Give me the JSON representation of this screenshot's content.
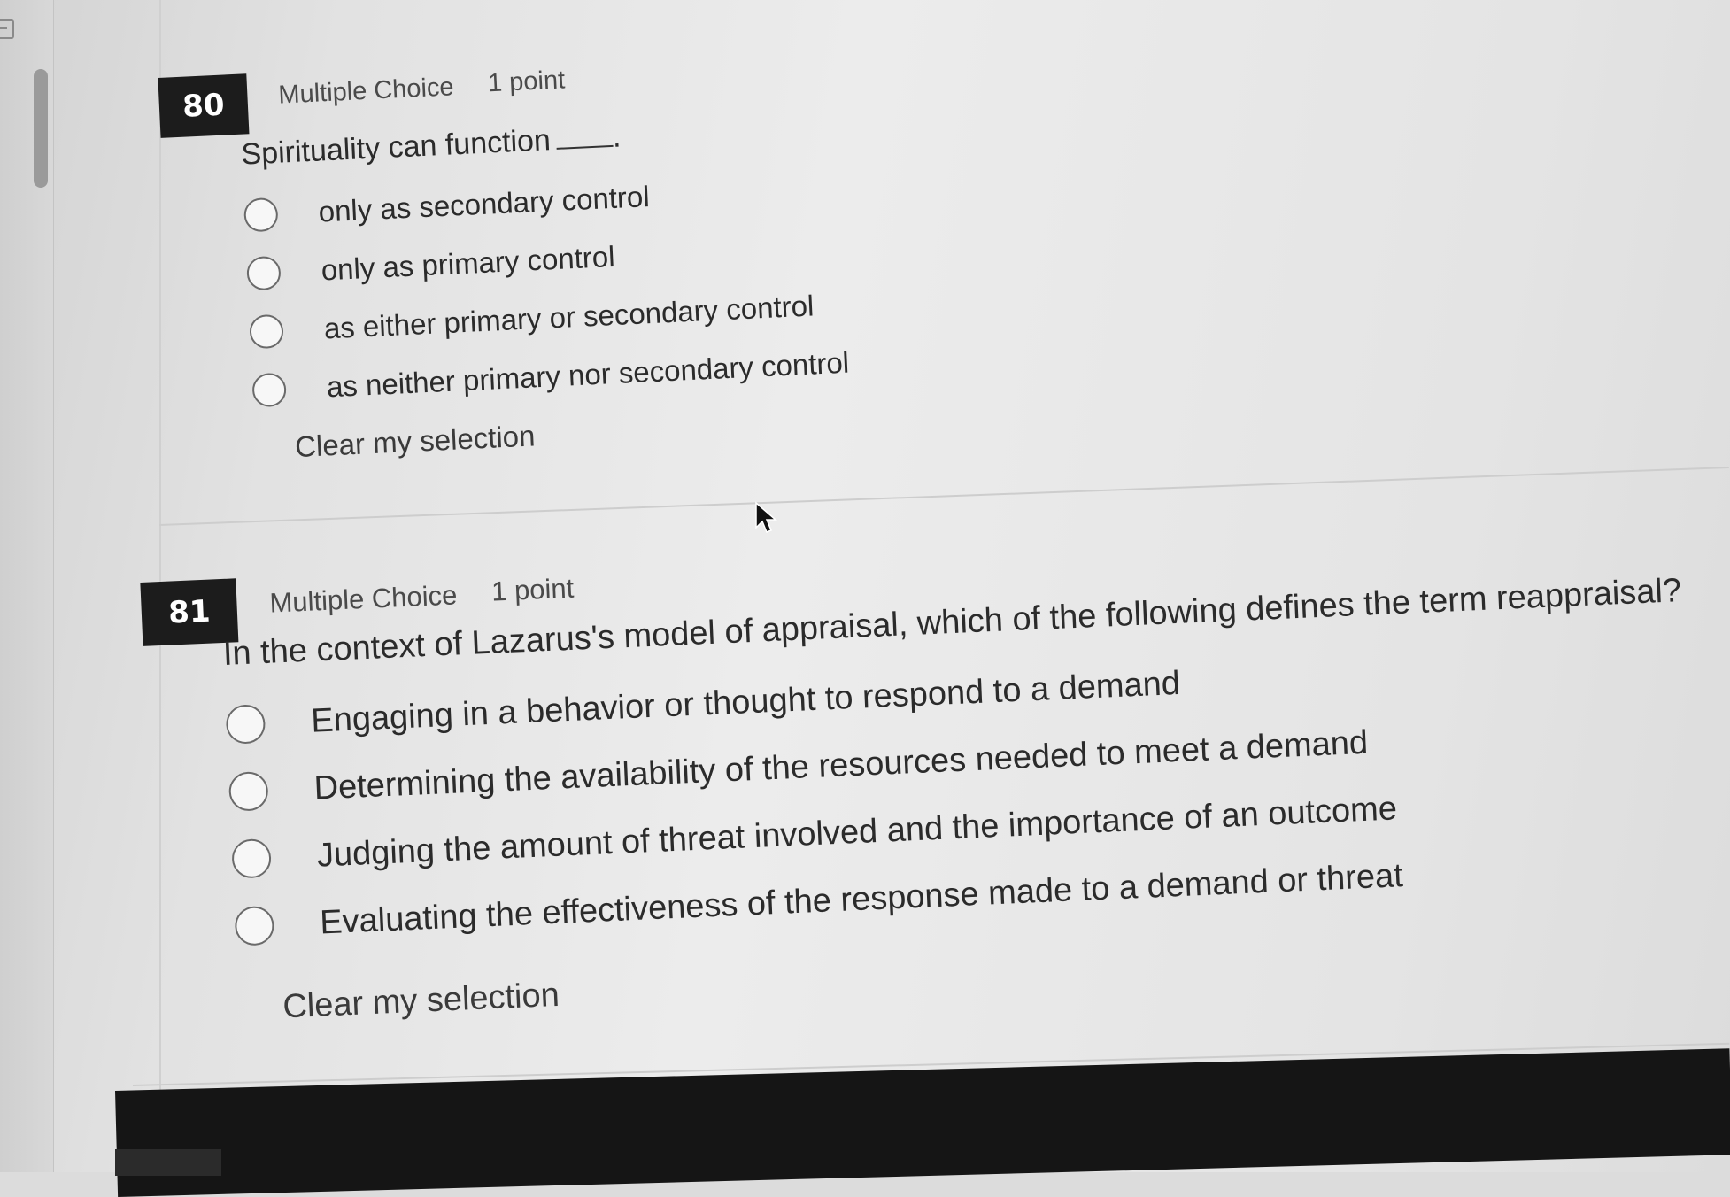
{
  "questions": [
    {
      "number": "80",
      "type": "Multiple Choice",
      "points": "1 point",
      "prompt": "Spirituality can function",
      "prompt_suffix": ".",
      "options": [
        "only as secondary control",
        "only as primary control",
        "as either primary or secondary control",
        "as neither primary nor secondary control"
      ],
      "clear_label": "Clear my selection"
    },
    {
      "number": "81",
      "type": "Multiple Choice",
      "points": "1 point",
      "prompt": "In the context of Lazarus's model of appraisal, which of the following defines the term reappraisal?",
      "options": [
        "Engaging in a behavior or thought to respond to a demand",
        "Determining the availability of the resources needed to meet a demand",
        "Judging the amount of threat involved and the importance of an outcome",
        "Evaluating the effectiveness of the response made to a demand or threat"
      ],
      "clear_label": "Clear my selection"
    }
  ],
  "icons": {
    "gutter": "collapse-panel-icon",
    "pointer": "mouse-pointer-icon"
  },
  "colors": {
    "badge_background": "#1c1c1c",
    "badge_text": "#ffffff",
    "page_background": "#e8e8e8",
    "radio_border": "#6a6a6a"
  }
}
